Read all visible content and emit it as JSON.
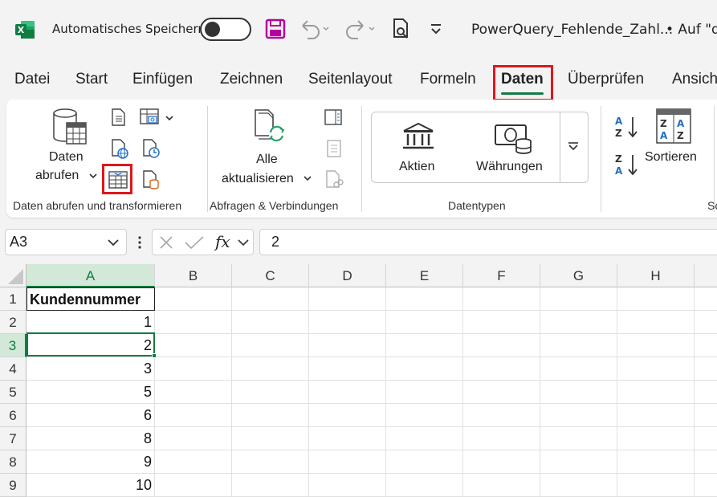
{
  "titlebar": {
    "autosave_label": "Automatisches Speichern",
    "document_title": "PowerQuery_Fehlende_Zahl...",
    "location_text": "• Auf \"d"
  },
  "menu": {
    "tabs": [
      "Datei",
      "Start",
      "Einfügen",
      "Zeichnen",
      "Seitenlayout",
      "Formeln",
      "Daten",
      "Überprüfen",
      "Ansich"
    ],
    "active_tab": "Daten"
  },
  "ribbon": {
    "get_data": {
      "line1": "Daten",
      "line2": "abrufen"
    },
    "refresh_all": {
      "line1": "Alle",
      "line2": "aktualisieren"
    },
    "data_types": {
      "stocks": "Aktien",
      "currencies": "Währungen"
    },
    "sort": {
      "label": "Sortieren"
    },
    "groups": {
      "get_transform": "Daten abrufen und transformieren",
      "queries": "Abfragen & Verbindungen",
      "datatypes": "Datentypen",
      "sort_cut": "So"
    }
  },
  "formula_bar": {
    "name_box": "A3",
    "formula": "2",
    "fx": "fx"
  },
  "grid": {
    "columns": [
      "A",
      "B",
      "C",
      "D",
      "E",
      "F",
      "G",
      "H"
    ],
    "selected_column": "A",
    "rows": [
      {
        "num": "1",
        "a": "Kundennummer"
      },
      {
        "num": "2",
        "a": "1"
      },
      {
        "num": "3",
        "a": "2"
      },
      {
        "num": "4",
        "a": "3"
      },
      {
        "num": "5",
        "a": "5"
      },
      {
        "num": "6",
        "a": "6"
      },
      {
        "num": "7",
        "a": "8"
      },
      {
        "num": "8",
        "a": "9"
      },
      {
        "num": "9",
        "a": "10"
      }
    ],
    "selected_row": "3"
  },
  "colors": {
    "excel_green": "#107c41",
    "highlight_red": "#e0161d",
    "save_purple": "#b4009e"
  },
  "icons": [
    "excel-logo-icon",
    "save-icon",
    "undo-icon",
    "redo-icon",
    "print-preview-icon",
    "customize-qat-icon",
    "database-table-icon",
    "from-table-range-icon",
    "refresh-icon",
    "bank-icon",
    "currency-icon",
    "sort-az-icon",
    "sort-za-icon"
  ]
}
